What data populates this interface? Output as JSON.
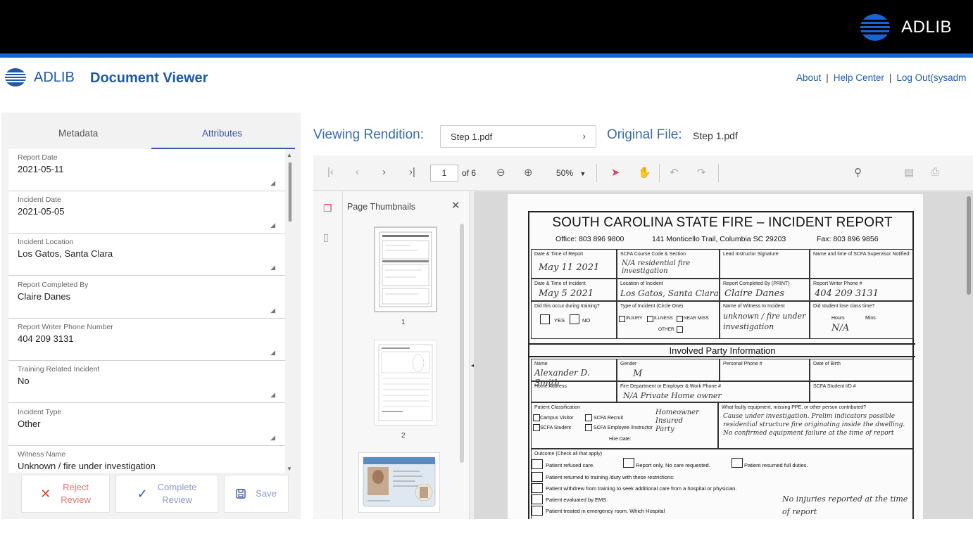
{
  "brand": {
    "name": "ADLIB",
    "app_title": "Document Viewer"
  },
  "header_links": {
    "about": "About",
    "help": "Help Center",
    "logout": "Log Out(sysadm"
  },
  "tabs": {
    "metadata": "Metadata",
    "attributes": "Attributes",
    "active": "Attributes"
  },
  "fields": [
    {
      "label": "Report Date",
      "value": "2021-05-11"
    },
    {
      "label": "Incident Date",
      "value": "2021-05-05"
    },
    {
      "label": "Incident Location",
      "value": "Los Gatos, Santa Clara"
    },
    {
      "label": "Report Completed By",
      "value": "Claire Danes"
    },
    {
      "label": "Report Writer Phone Number",
      "value": "404 209 3131"
    },
    {
      "label": "Training Related Incident",
      "value": "No"
    },
    {
      "label": "Incident Type",
      "value": "Other"
    },
    {
      "label": "Witness Name",
      "value": "Unknown / fire under investigation"
    }
  ],
  "actions": {
    "reject_1": "Reject",
    "reject_2": "Review",
    "complete_1": "Complete",
    "complete_2": "Review",
    "save": "Save"
  },
  "viewer": {
    "viewing_label": "Viewing Rendition:",
    "rendition": "Step 1.pdf",
    "original_label": "Original File:",
    "original_value": "Step 1.pdf",
    "page": "1",
    "page_of": "of 6",
    "zoom": "50%",
    "thumbs_title": "Page Thumbnails",
    "thumb_numbers": [
      "1",
      "2"
    ]
  },
  "document": {
    "title": "SOUTH CAROLINA STATE FIRE – INCIDENT REPORT",
    "office": "Office: 803 896 9800",
    "address": "141 Monticello Trail, Columbia SC 29203",
    "fax": "Fax: 803 896 9856",
    "labels": {
      "date_time_report": "Date & Time of Report",
      "course_code": "SCFA Course Code & Section",
      "lead_sig": "Lead Instructor Signature",
      "supervisor": "Name and time of SCFA Supervisor Notified:",
      "date_time_incident": "Date & Time of Incident",
      "location": "Location of Incident",
      "report_completed_by": "Report Completed By (PRINT)",
      "writer_phone": "Report Writer Phone #",
      "during_training": "Did this occur during training?",
      "incident_type": "Type of Incident (Circle One)",
      "witness": "Name of Witness to Incident",
      "lose_class": "Did student lose class time?",
      "yes": "YES",
      "no": "NO",
      "injury": "INJURY",
      "illness": "ILLNESS",
      "near_miss": "NEAR MISS",
      "other": "OTHER",
      "hours": "Hours",
      "mins": "Mins",
      "involved": "Involved Party Information",
      "name": "Name",
      "gender": "Gender",
      "personal_phone": "Personal Phone #",
      "dob": "Date of Birth",
      "home_address": "Home Address",
      "dept_employer": "Fire Department or Employer & Work Phone #",
      "student_id": "SCFA Student I/D #",
      "patient_class": "Patient Classification",
      "faulty": "What faulty equipment, missing PPE, or other person contributed?",
      "campus_visitor": "Campus Visitor",
      "scfa_recruit": "SCFA Recruit",
      "scfa_student": "SCFA Student",
      "scfa_employee": "SCFA Employee /Instructor",
      "hire_date": "Hire Date:",
      "outcome": "Outcome  (Check all that apply)",
      "refused": "Patient refused care.",
      "report_only": "Report only, No care requested.",
      "resumed": "Patient resumed full duties.",
      "returned": "Patient returned to training /duty with these restrictions:",
      "withdrew": "Patient withdrew from training to seek additional care from a hospital or physician.",
      "ems": "Patient evaluated by EMS.",
      "er": "Patient treated in emergency room.  Which Hospital"
    },
    "handwriting": {
      "report_date": "May 11 2021",
      "course": "N/A  residential fire investigation",
      "incident_date": "May 5 2021",
      "location": "Los Gatos, Santa Clara",
      "completed_by": "Claire Danes",
      "phone": "404 209 3131",
      "witness": "unknown / fire under investigation",
      "lose_time": "N/A",
      "name": "Alexander D. Smith",
      "gender": "M",
      "employer": "N/A   Private Home owner",
      "classification": "Homeowner Insured Party",
      "contributed": "Cause under investigation. Prelim indicators possible residential structure fire originating inside the dwelling. No confirmed equipment failure at the time of report",
      "no_injuries": "No injuries reported at the time of report"
    }
  }
}
